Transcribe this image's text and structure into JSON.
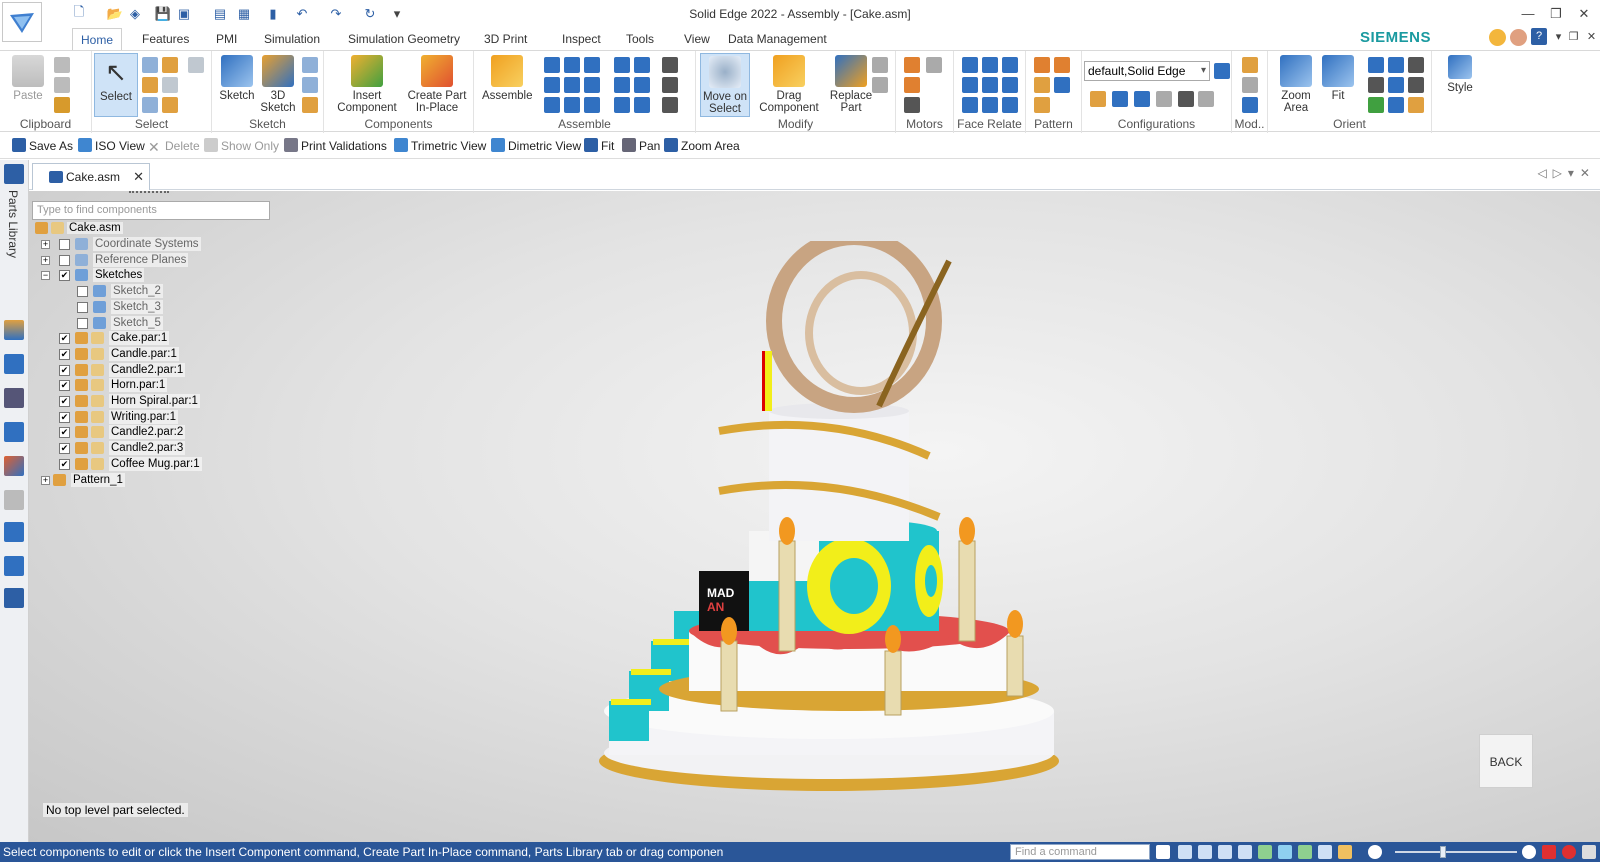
{
  "app": {
    "title": "Solid Edge 2022 - Assembly - [Cake.asm]",
    "brand": "SIEMENS"
  },
  "tabs": [
    "Home",
    "Features",
    "PMI",
    "Simulation",
    "Simulation Geometry",
    "3D Print",
    "Inspect",
    "Tools",
    "View",
    "Data Management"
  ],
  "active_tab": "Home",
  "ribbon": {
    "groups": [
      "Clipboard",
      "Select",
      "Sketch",
      "Components",
      "Assemble",
      "Modify",
      "Motors",
      "Face Relate",
      "Pattern",
      "Configurations",
      "Mod..",
      "Orient"
    ],
    "buttons": {
      "paste": "Paste",
      "select": "Select",
      "sketch": "Sketch",
      "sketch3d_1": "3D",
      "sketch3d_2": "Sketch",
      "insert_component_1": "Insert",
      "insert_component_2": "Component",
      "create_part_1": "Create Part",
      "create_part_2": "In-Place",
      "assemble": "Assemble",
      "move_on_select_1": "Move on",
      "move_on_select_2": "Select",
      "drag_component_1": "Drag",
      "drag_component_2": "Component",
      "replace_part_1": "Replace",
      "replace_part_2": "Part",
      "zoom_area_1": "Zoom",
      "zoom_area_2": "Area",
      "fit": "Fit",
      "style": "Style"
    },
    "configuration_value": "default,Solid Edge"
  },
  "quickbar": {
    "save_as": "Save As",
    "iso_view": "ISO View",
    "delete": "Delete",
    "show_only": "Show Only",
    "print_validations": "Print Validations",
    "trimetric_view": "Trimetric View",
    "dimetric_view": "Dimetric View",
    "fit": "Fit",
    "pan": "Pan",
    "zoom_area": "Zoom Area"
  },
  "rail": {
    "parts_library": "Parts Library"
  },
  "document_tab": "Cake.asm",
  "pathfinder": {
    "placeholder": "Type to find components",
    "root": "Cake.asm",
    "items": [
      {
        "label": "Coordinate Systems",
        "checked": false,
        "muted": true
      },
      {
        "label": "Reference Planes",
        "checked": false,
        "muted": true
      },
      {
        "label": "Sketches",
        "checked": true,
        "muted": false
      },
      {
        "label": "Sketch_2",
        "checked": false,
        "muted": true
      },
      {
        "label": "Sketch_3",
        "checked": false,
        "muted": true
      },
      {
        "label": "Sketch_5",
        "checked": false,
        "muted": true
      },
      {
        "label": "Cake.par:1",
        "checked": true,
        "muted": false
      },
      {
        "label": "Candle.par:1",
        "checked": true,
        "muted": false
      },
      {
        "label": "Candle2.par:1",
        "checked": true,
        "muted": false
      },
      {
        "label": "Horn.par:1",
        "checked": true,
        "muted": false
      },
      {
        "label": "Horn Spiral.par:1",
        "checked": true,
        "muted": false
      },
      {
        "label": "Writing.par:1",
        "checked": true,
        "muted": false
      },
      {
        "label": "Candle2.par:2",
        "checked": true,
        "muted": false
      },
      {
        "label": "Candle2.par:3",
        "checked": true,
        "muted": false
      },
      {
        "label": "Coffee Mug.par:1",
        "checked": true,
        "muted": false
      },
      {
        "label": "Pattern_1",
        "checked": null,
        "muted": false
      }
    ]
  },
  "viewport": {
    "selection_status": "No top level part selected.",
    "back_button": "BACK",
    "mug_text_1": "MAD",
    "mug_text_2": "AN"
  },
  "statusbar": {
    "prompt": "Select components to edit or click the Insert Component command, Create Part In-Place command, Parts Library tab or drag componen",
    "find_placeholder": "Find a command"
  },
  "colors": {
    "accent": "#2d5fa5",
    "statusbar": "#2a5698",
    "brand": "#1a9aa0",
    "cake_cyan": "#20c4cc",
    "cake_yellow": "#f2ee1a",
    "cake_red": "#e2504d",
    "gold": "#d9a534"
  }
}
